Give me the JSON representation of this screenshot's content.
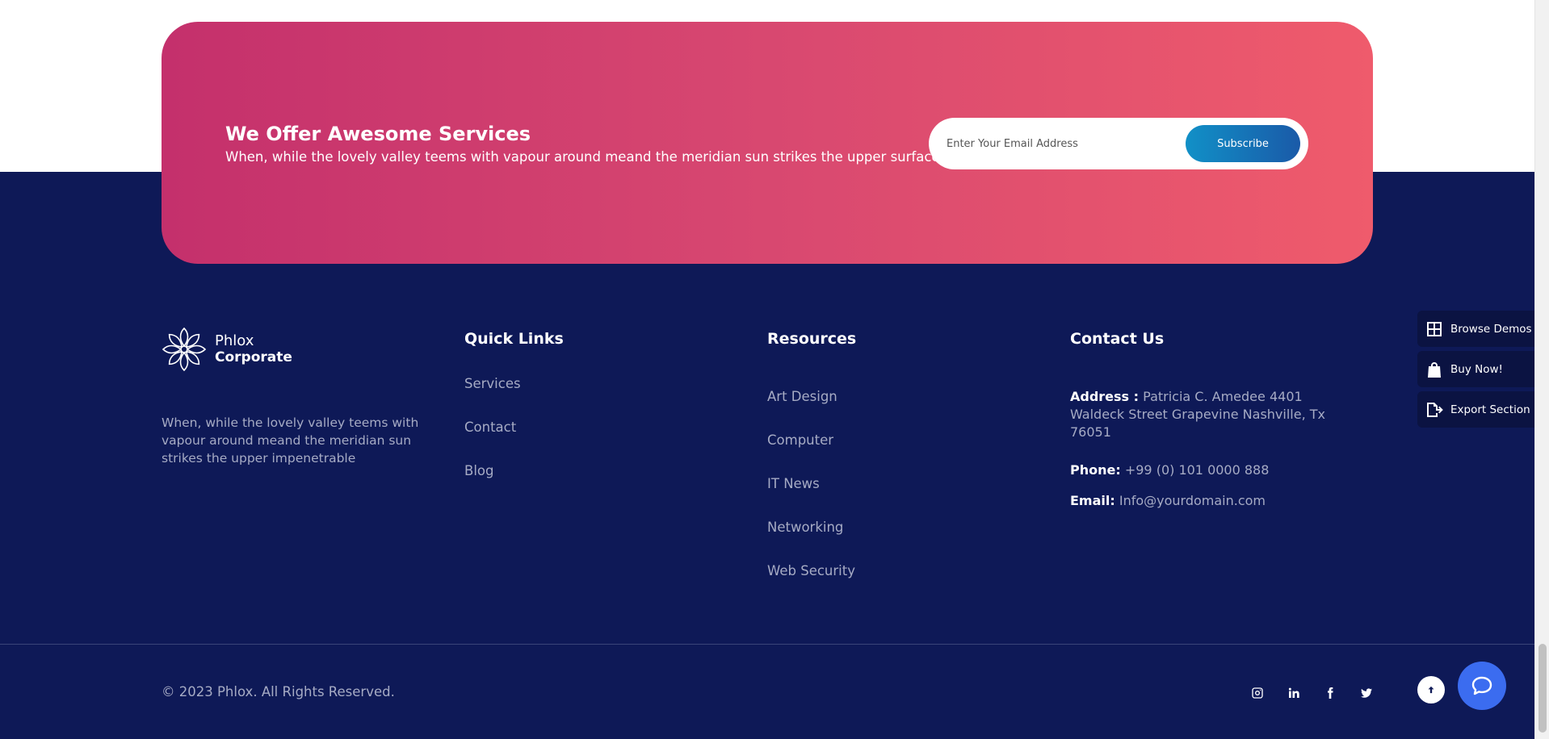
{
  "cta": {
    "title": "We Offer Awesome Services",
    "subtitle": "When, while the lovely valley teems with vapour around meand the meridian sun strikes the upper surfaces .",
    "email_placeholder": "Enter Your Email Address",
    "subscribe_label": "Subscribe"
  },
  "brand": {
    "line1": "Phlox",
    "line2": "Corporate",
    "logo_icon": "lotus-logo-icon"
  },
  "about": {
    "text": "When, while the lovely valley teems with vapour around meand the meridian sun strikes the upper impenetrable"
  },
  "quick_links": {
    "title": "Quick Links",
    "items": [
      {
        "label": "Services"
      },
      {
        "label": "Contact"
      },
      {
        "label": "Blog"
      }
    ]
  },
  "resources": {
    "title": "Resources",
    "items": [
      {
        "label": "Art Design"
      },
      {
        "label": "Computer"
      },
      {
        "label": "IT News"
      },
      {
        "label": "Networking"
      },
      {
        "label": "Web Security"
      }
    ]
  },
  "contact": {
    "title": "Contact Us",
    "address_label": "Address :",
    "address_value": "Patricia C. Amedee 4401 Waldeck Street Grapevine Nashville, Tx 76051",
    "phone_label": "Phone:",
    "phone_value": "+99 (0) 101 0000 888",
    "email_label": "Email:",
    "email_value": "Info@yourdomain.com"
  },
  "footer": {
    "copyright": "© 2023 Phlox. All Rights Reserved.",
    "social_icons": [
      "instagram-icon",
      "linkedin-icon",
      "facebook-icon",
      "twitter-icon"
    ]
  },
  "side_panel": {
    "items": [
      {
        "label": "Browse Demos",
        "icon": "grid-icon"
      },
      {
        "label": "Buy Now!",
        "icon": "shopping-bag-icon"
      },
      {
        "label": "Export Section",
        "icon": "export-file-icon"
      }
    ]
  },
  "colors": {
    "footer_bg": "#0e1957",
    "cta_gradient_start": "#c4306c",
    "cta_gradient_end": "#ef5b6c",
    "subscribe_gradient_start": "#1190c7",
    "subscribe_gradient_end": "#1a5aa8",
    "chat_button": "#3b6cf0",
    "muted_text": "#a6abc4"
  }
}
